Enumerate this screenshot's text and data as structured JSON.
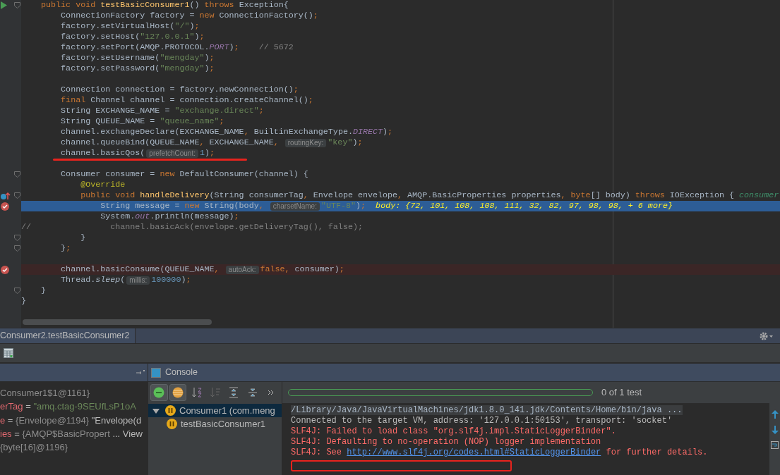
{
  "editor": {
    "lines": [
      {
        "kind": "normal",
        "run_marker": true,
        "fold": true,
        "tokens": [
          {
            "kind": "keyword",
            "text": "    public void "
          },
          {
            "kind": "method",
            "text": "testBasicConsumer1"
          },
          {
            "kind": "plain",
            "text": "() "
          },
          {
            "kind": "keyword",
            "text": "throws "
          },
          {
            "kind": "plain",
            "text": "Exception{"
          }
        ]
      },
      {
        "kind": "normal",
        "tokens": [
          {
            "kind": "plain",
            "text": "        ConnectionFactory factory = "
          },
          {
            "kind": "keyword",
            "text": "new "
          },
          {
            "kind": "plain",
            "text": "ConnectionFactory()"
          },
          {
            "kind": "keyword",
            "text": ";"
          }
        ]
      },
      {
        "kind": "normal",
        "tokens": [
          {
            "kind": "plain",
            "text": "        factory.setVirtualHost("
          },
          {
            "kind": "string",
            "text": "\"/\""
          },
          {
            "kind": "plain",
            "text": ")"
          },
          {
            "kind": "keyword",
            "text": ";"
          }
        ]
      },
      {
        "kind": "normal",
        "tokens": [
          {
            "kind": "plain",
            "text": "        factory.setHost("
          },
          {
            "kind": "string",
            "text": "\"127.0.0.1\""
          },
          {
            "kind": "plain",
            "text": ")"
          },
          {
            "kind": "keyword",
            "text": ";"
          }
        ]
      },
      {
        "kind": "normal",
        "tokens": [
          {
            "kind": "plain",
            "text": "        factory.setPort(AMQP.PROTOCOL."
          },
          {
            "kind": "field",
            "text": "PORT"
          },
          {
            "kind": "plain",
            "text": ")"
          },
          {
            "kind": "keyword",
            "text": ";"
          },
          {
            "kind": "comment",
            "text": "    // 5672"
          }
        ]
      },
      {
        "kind": "normal",
        "tokens": [
          {
            "kind": "plain",
            "text": "        factory.setUsername("
          },
          {
            "kind": "string",
            "text": "\"mengday\""
          },
          {
            "kind": "plain",
            "text": ")"
          },
          {
            "kind": "keyword",
            "text": ";"
          }
        ]
      },
      {
        "kind": "normal",
        "tokens": [
          {
            "kind": "plain",
            "text": "        factory.setPassword("
          },
          {
            "kind": "string",
            "text": "\"mengday\""
          },
          {
            "kind": "plain",
            "text": ")"
          },
          {
            "kind": "keyword",
            "text": ";"
          }
        ]
      },
      {
        "kind": "normal"
      },
      {
        "kind": "normal",
        "tokens": [
          {
            "kind": "plain",
            "text": "        Connection connection = factory.newConnection()"
          },
          {
            "kind": "keyword",
            "text": ";"
          }
        ]
      },
      {
        "kind": "normal",
        "tokens": [
          {
            "kind": "keyword",
            "text": "        final "
          },
          {
            "kind": "plain",
            "text": "Channel channel = connection.createChannel()"
          },
          {
            "kind": "keyword",
            "text": ";"
          }
        ]
      },
      {
        "kind": "normal",
        "tokens": [
          {
            "kind": "plain",
            "text": "        String EXCHANGE_NAME = "
          },
          {
            "kind": "string",
            "text": "\"exchange.direct\""
          },
          {
            "kind": "keyword",
            "text": ";"
          }
        ]
      },
      {
        "kind": "normal",
        "tokens": [
          {
            "kind": "plain",
            "text": "        String QUEUE_NAME = "
          },
          {
            "kind": "string",
            "text": "\"queue_name\""
          },
          {
            "kind": "keyword",
            "text": ";"
          }
        ]
      },
      {
        "kind": "normal",
        "tokens": [
          {
            "kind": "plain",
            "text": "        channel.exchangeDeclare(EXCHANGE_NAME"
          },
          {
            "kind": "keyword",
            "text": ", "
          },
          {
            "kind": "plain",
            "text": "BuiltinExchangeType."
          },
          {
            "kind": "field",
            "text": "DIRECT"
          },
          {
            "kind": "plain",
            "text": ")"
          },
          {
            "kind": "keyword",
            "text": ";"
          }
        ]
      },
      {
        "kind": "normal",
        "tokens": [
          {
            "kind": "plain",
            "text": "        channel.queueBind(QUEUE_NAME"
          },
          {
            "kind": "keyword",
            "text": ", "
          },
          {
            "kind": "plain",
            "text": "EXCHANGE_NAME"
          },
          {
            "kind": "keyword",
            "text": ", "
          },
          {
            "kind": "hint",
            "text": "routingKey:"
          },
          {
            "kind": "string",
            "text": "\"key\""
          },
          {
            "kind": "plain",
            "text": ")"
          },
          {
            "kind": "keyword",
            "text": ";"
          }
        ]
      },
      {
        "kind": "normal",
        "underlined": true,
        "tokens": [
          {
            "kind": "plain",
            "text": "        channel.basicQos("
          },
          {
            "kind": "hint",
            "text": "prefetchCount:"
          },
          {
            "kind": "number",
            "text": "1"
          },
          {
            "kind": "plain",
            "text": ")"
          },
          {
            "kind": "keyword",
            "text": ";"
          }
        ]
      },
      {
        "kind": "normal"
      },
      {
        "kind": "normal",
        "fold": true,
        "tokens": [
          {
            "kind": "plain",
            "text": "        Consumer consumer = "
          },
          {
            "kind": "keyword",
            "text": "new "
          },
          {
            "kind": "plain",
            "text": "DefaultConsumer(channel) {"
          }
        ]
      },
      {
        "kind": "normal",
        "tokens": [
          {
            "kind": "annotation",
            "text": "            @Override"
          }
        ]
      },
      {
        "kind": "normal",
        "override_marker": true,
        "fold": true,
        "tokens": [
          {
            "kind": "keyword",
            "text": "            public void "
          },
          {
            "kind": "method",
            "text": "handleDelivery"
          },
          {
            "kind": "plain",
            "text": "(String consumerTag"
          },
          {
            "kind": "keyword",
            "text": ", "
          },
          {
            "kind": "plain",
            "text": "Envelope envelope"
          },
          {
            "kind": "keyword",
            "text": ", "
          },
          {
            "kind": "plain",
            "text": "AMQP.BasicProperties properties"
          },
          {
            "kind": "keyword",
            "text": ", byte"
          },
          {
            "kind": "plain",
            "text": "[] body) "
          },
          {
            "kind": "keyword",
            "text": "throws "
          },
          {
            "kind": "plain",
            "text": "IOException {"
          },
          {
            "kind": "value",
            "text": " consumer"
          }
        ]
      },
      {
        "kind": "execution",
        "breakpoint": true,
        "tokens": [
          {
            "kind": "plain",
            "text": "                String message = "
          },
          {
            "kind": "keyword",
            "text": "new "
          },
          {
            "kind": "plain",
            "text": "String(body"
          },
          {
            "kind": "keyword",
            "text": ", "
          },
          {
            "kind": "hint",
            "text": "charsetName:"
          },
          {
            "kind": "string",
            "text": "\"UTF-8\""
          },
          {
            "kind": "plain",
            "text": ")"
          },
          {
            "kind": "keyword",
            "text": ";"
          },
          {
            "kind": "debug",
            "text": "  body: {72, 101, 108, 108, 111, 32, 82, 97, 98, 98, + 6 more}"
          }
        ]
      },
      {
        "kind": "normal",
        "tokens": [
          {
            "kind": "plain",
            "text": "                System."
          },
          {
            "kind": "field",
            "text": "out"
          },
          {
            "kind": "plain",
            "text": ".println(message)"
          },
          {
            "kind": "keyword",
            "text": ";"
          }
        ]
      },
      {
        "kind": "normal",
        "tokens": [
          {
            "kind": "comment",
            "text": "//                channel.basicAck(envelope.getDeliveryTag(), false);"
          }
        ]
      },
      {
        "kind": "normal",
        "fold": true,
        "tokens": [
          {
            "kind": "plain",
            "text": "            }"
          }
        ]
      },
      {
        "kind": "normal",
        "fold": true,
        "tokens": [
          {
            "kind": "plain",
            "text": "        }"
          },
          {
            "kind": "keyword",
            "text": ";"
          }
        ]
      },
      {
        "kind": "normal"
      },
      {
        "kind": "breakpoint",
        "breakpoint": true,
        "tokens": [
          {
            "kind": "plain",
            "text": "        channel.basicConsume(QUEUE_NAME"
          },
          {
            "kind": "keyword",
            "text": ", "
          },
          {
            "kind": "hint",
            "text": "autoAck:"
          },
          {
            "kind": "keyword",
            "text": "false, "
          },
          {
            "kind": "plain",
            "text": "consumer)"
          },
          {
            "kind": "keyword",
            "text": ";"
          }
        ]
      },
      {
        "kind": "normal",
        "tokens": [
          {
            "kind": "plain",
            "text": "        Thread."
          },
          {
            "kind": "italic",
            "text": "sleep"
          },
          {
            "kind": "plain",
            "text": "("
          },
          {
            "kind": "hint",
            "text": "millis:"
          },
          {
            "kind": "number",
            "text": "100000"
          },
          {
            "kind": "plain",
            "text": ")"
          },
          {
            "kind": "keyword",
            "text": ";"
          }
        ]
      },
      {
        "kind": "normal",
        "fold": true,
        "tokens": [
          {
            "kind": "plain",
            "text": "    }"
          }
        ]
      },
      {
        "kind": "normal",
        "tokens": [
          {
            "kind": "plain",
            "text": "}"
          }
        ]
      }
    ]
  },
  "run_tab": {
    "label": "Consumer2.testBasicConsumer2"
  },
  "variables": [
    {
      "kind": "object",
      "value": "Consumer1$1@1161}"
    },
    {
      "kind": "string",
      "name": "erTag",
      "operator": "=",
      "value": "\"amq.ctag-9SEUfLsP1oA"
    },
    {
      "kind": "object",
      "name": "e",
      "operator": "=",
      "value": "{Envelope@1194}",
      "extra": "\"Envelope(d"
    },
    {
      "kind": "object",
      "name": "ies",
      "operator": "=",
      "value": "{AMQP$BasicPropert",
      "extra": "... View"
    },
    {
      "kind": "object",
      "value": "{byte[16]@1196}"
    }
  ],
  "console_tab": {
    "label": "Console"
  },
  "test_toolbar": [
    {
      "kind": "passed",
      "selected": true
    },
    {
      "kind": "ignored",
      "selected": true
    },
    {
      "kind": "sort-alpha",
      "selected": false
    },
    {
      "kind": "sort-duration",
      "selected": false
    },
    {
      "kind": "expand",
      "selected": false
    },
    {
      "kind": "collapse",
      "selected": false
    },
    {
      "kind": "more",
      "selected": false
    }
  ],
  "progress": {
    "level": 0,
    "label": "0 of 1 test"
  },
  "test_tree": [
    {
      "label": "Consumer1 (com.meng",
      "selected": true,
      "expanded": true,
      "children": [
        {
          "label": "testBasicConsumer1",
          "selected": false
        }
      ]
    }
  ],
  "console": {
    "lines": [
      {
        "kind": "command",
        "text": "/Library/Java/JavaVirtualMachines/jdk1.8.0_141.jdk/Contents/Home/bin/java ..."
      },
      {
        "kind": "info",
        "text": "Connected to the target VM, address: '127.0.0.1:50153', transport: 'socket'"
      },
      {
        "kind": "error",
        "text": "SLF4J: Failed to load class \"org.slf4j.impl.StaticLoggerBinder\"."
      },
      {
        "kind": "error",
        "text": "SLF4J: Defaulting to no-operation (NOP) logger implementation"
      },
      {
        "kind": "error",
        "text": "SLF4J: See ",
        "link": "http://www.slf4j.org/codes.html#StaticLoggerBinder",
        "after": " for further details."
      }
    ],
    "marked_blank_line": true
  }
}
